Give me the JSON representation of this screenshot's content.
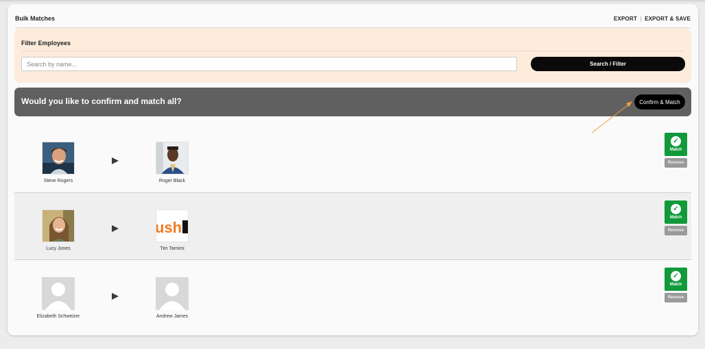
{
  "header": {
    "title": "Bulk Matches",
    "export_label": "EXPORT",
    "separator": "|",
    "export_save_label": "EXPORT & SAVE"
  },
  "filter": {
    "title": "Filter Employees",
    "search_placeholder": "Search by name...",
    "search_value": "",
    "button_label": "Search / Filter"
  },
  "confirm": {
    "question": "Would you like to confirm and match all?",
    "button_label": "Confirm & Match"
  },
  "rows": [
    {
      "left": {
        "name": "Steve Rogers",
        "avatar": "photo-man-smiling"
      },
      "right": {
        "name": "Roger Black",
        "avatar": "photo-man-blue-suit"
      },
      "match_label": "Match",
      "remove_label": "Remove"
    },
    {
      "left": {
        "name": "Lucy Jones",
        "avatar": "photo-woman-smiling"
      },
      "right": {
        "name": "Tim Tamimi",
        "avatar": "logo-orange-black"
      },
      "match_label": "Match",
      "remove_label": "Remove"
    },
    {
      "left": {
        "name": "Elizabeth Schweizer",
        "avatar": "default-avatar-icon"
      },
      "right": {
        "name": "Andrew James",
        "avatar": "default-avatar-icon"
      },
      "match_label": "Match",
      "remove_label": "Remove"
    }
  ],
  "colors": {
    "filter_bg": "#fdecdc",
    "confirm_bar_bg": "#606060",
    "match_green": "#119a3a",
    "remove_gray": "#9a9a9a",
    "annotation_arrow": "#f2a33a"
  }
}
